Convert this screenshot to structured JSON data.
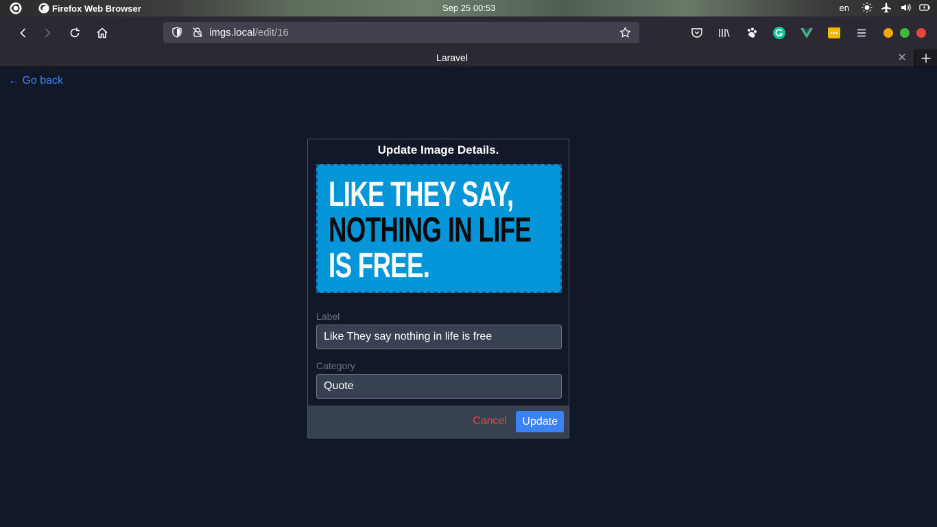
{
  "system_bar": {
    "app_name": "Firefox Web Browser",
    "clock": "Sep 25  00:53",
    "language": "en"
  },
  "browser": {
    "url_host": "imgs.local",
    "url_path": "/edit/16",
    "tab_title": "Laravel"
  },
  "page": {
    "back_link": "← Go back",
    "card_title": "Update Image Details.",
    "image": {
      "lines": [
        "LIKE THEY SAY,",
        "NOTHING IN LIFE",
        "IS FREE."
      ],
      "background_color": "#0595d9"
    },
    "label_field": {
      "label": "Label",
      "value": "Like They say nothing in life is free"
    },
    "category_field": {
      "label": "Category",
      "value": "Quote"
    },
    "cancel_label": "Cancel",
    "update_label": "Update"
  },
  "colors": {
    "accent": "#3b82f6",
    "danger": "#ef4444",
    "page_background": "#111827"
  }
}
